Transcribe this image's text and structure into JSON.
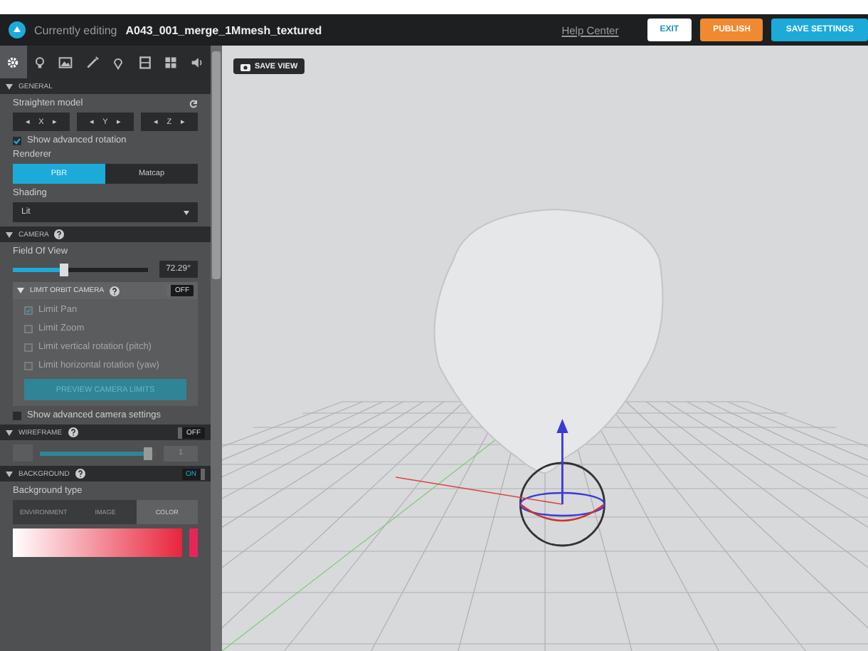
{
  "topbar": {
    "editing_label": "Currently editing",
    "model_name": "A043_001_merge_1Mmesh_textured",
    "help": "Help Center",
    "buttons": [
      {
        "label": "EXIT",
        "kind": "plain"
      },
      {
        "label": "PUBLISH",
        "kind": "warn"
      },
      {
        "label": "SAVE SETTINGS",
        "kind": "primary"
      }
    ]
  },
  "tool_tabs": [
    {
      "selected": true
    },
    {
      "selected": false
    },
    {
      "selected": false
    },
    {
      "selected": false
    },
    {
      "selected": false
    },
    {
      "selected": false
    },
    {
      "selected": false
    },
    {
      "selected": false
    }
  ],
  "general": {
    "title": "GENERAL",
    "straighten_label": "Straighten model",
    "axes": [
      {
        "left": "◂",
        "axis": "X",
        "right": "▸"
      },
      {
        "left": "◂",
        "axis": "Y",
        "right": "▸"
      },
      {
        "left": "◂",
        "axis": "Z",
        "right": "▸"
      }
    ],
    "advanced_rotation": {
      "label": "Show advanced rotation",
      "checked": true
    },
    "renderer_label": "Renderer",
    "renderers": [
      {
        "label": "PBR",
        "selected": true
      },
      {
        "label": "Matcap",
        "selected": false
      }
    ],
    "shading_label": "Shading",
    "shading_value": "Lit"
  },
  "camera": {
    "title": "CAMERA",
    "fov_label": "Field Of View",
    "fov": {
      "level": 0.38
    },
    "fov_value": "72.29°",
    "limit_orbit": {
      "title": "LIMIT ORBIT CAMERA",
      "toggle": {
        "label": "OFF",
        "on": false
      },
      "options": [
        {
          "label": "Limit Pan",
          "checked": true,
          "disabled": true
        },
        {
          "label": "Limit Zoom",
          "checked": false,
          "disabled": true
        },
        {
          "label": "Limit vertical rotation (pitch)",
          "checked": false,
          "disabled": true
        },
        {
          "label": "Limit horizontal rotation (yaw)",
          "checked": false,
          "disabled": true
        }
      ],
      "preview_button": "PREVIEW CAMERA LIMITS"
    },
    "advanced": {
      "label": "Show advanced camera settings",
      "checked": false
    }
  },
  "wireframe": {
    "title": "WIREFRAME",
    "toggle": {
      "label": "OFF",
      "on": false
    },
    "thickness": {
      "level": 0.93
    },
    "value": "1"
  },
  "background": {
    "title": "BACKGROUND",
    "toggle": {
      "label": "ON",
      "on": true
    },
    "type_label": "Background type",
    "types": [
      {
        "label": "ENVIRONMENT",
        "selected": false
      },
      {
        "label": "IMAGE",
        "selected": false
      },
      {
        "label": "COLOR",
        "selected": true
      }
    ]
  },
  "viewport": {
    "save_view": "SAVE VIEW"
  }
}
